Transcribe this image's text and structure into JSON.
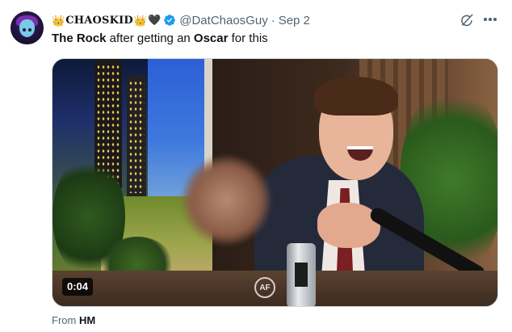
{
  "author": {
    "display_name": "CHAOSKID",
    "name_prefix_emoji": "👑",
    "name_suffix_emoji": "👑",
    "heart_emoji": "🖤",
    "handle": "@DatChaosGuy",
    "separator": "·",
    "timestamp": "Sep 2",
    "verified_color": "#1d9bf0"
  },
  "tweet": {
    "text_parts": {
      "bold_1": "The Rock",
      "plain_1": " after getting an ",
      "bold_2": "Oscar",
      "plain_2": " for this"
    }
  },
  "media": {
    "type": "video",
    "duration": "0:04",
    "watermark": "AF"
  },
  "source": {
    "label": "From",
    "name": "HM"
  },
  "icons": {
    "grok": "grok-icon",
    "more": "more-options-icon",
    "verified": "verified-badge-icon"
  },
  "colors": {
    "text_primary": "#0f1419",
    "text_secondary": "#536471",
    "border": "#cfd9de"
  }
}
